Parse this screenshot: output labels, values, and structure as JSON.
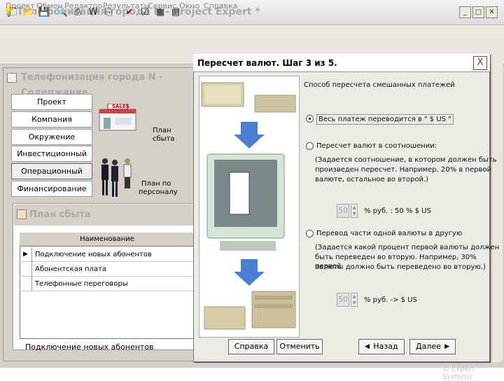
{
  "app": {
    "title": "Телефонизация города N - Project Expert *"
  },
  "window_controls": {
    "minimize": "_",
    "maximize": "□",
    "close": "✕"
  },
  "menu": [
    "Проект",
    "Обмен",
    "Редактор",
    "Результаты",
    "Сервис",
    "Окно",
    "Справка"
  ],
  "inner": {
    "title": "Телефонизация города N - Содержание"
  },
  "nav": [
    "Проект",
    "Компания",
    "Окружение",
    "Инвестиционный план",
    "Операционный план",
    "Финансирование"
  ],
  "nav_selected": 4,
  "content": {
    "sales_sign": "SALES",
    "plan_sales": [
      "План",
      "сбыта"
    ],
    "plan_staff": [
      "План по",
      "персоналу"
    ]
  },
  "subwindow": {
    "title": "План сбыта",
    "column_header": "Наименование",
    "rows": [
      "Подключение новых абонентов",
      "Абонентская плата",
      "Телефонные переговоры"
    ],
    "row_marker": "▶",
    "footer_text": "Подключение новых абонентов"
  },
  "dialog": {
    "title": "Пересчет валют. Шаг 3 из 5.",
    "close": "X",
    "group_label": "Способ пересчета смешанных платежей",
    "option1": "Весь платеж переводится в \" $ US \"",
    "option2": "Пересчет валют в соотношении:",
    "option2_desc": [
      "(Задается соотношение, в котором должен быть",
      "произведен пересчет. Например, 20% в первой",
      "валюте, остальное во второй.)"
    ],
    "spin1_value": "50",
    "spin1_suffix": "% руб. : 50 % $ US",
    "option3": "Перевод части одной валюты в другую",
    "option3_desc": [
      "(Задается какой процент первой валюты должен",
      "быть переведен во вторую. Например, 30% первой",
      "валюты должно быть переведено во вторую.)"
    ],
    "spin2_value": "50",
    "spin2_suffix": "% руб. -> $ US",
    "selected_option": 1,
    "buttons": {
      "help": "Справка",
      "cancel": "Отменить",
      "back": "Назад",
      "next": "Далее"
    }
  },
  "copyright": "© Expert Systems"
}
